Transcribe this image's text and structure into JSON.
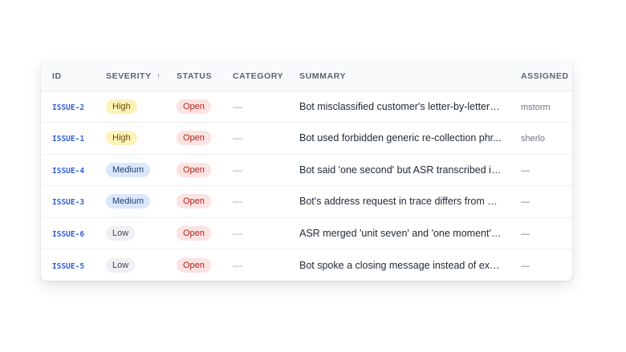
{
  "table": {
    "columns": {
      "id": "ID",
      "severity": "SEVERITY",
      "severity_sort_indicator": "↑",
      "status": "STATUS",
      "category": "CATEGORY",
      "summary": "SUMMARY",
      "assigned": "ASSIGNED"
    },
    "rows": [
      {
        "id": "ISSUE-2",
        "severity": "High",
        "status": "Open",
        "category": "—",
        "summary": "Bot misclassified customer's letter-by-letter s...",
        "assigned": "mstorm"
      },
      {
        "id": "ISSUE-1",
        "severity": "High",
        "status": "Open",
        "category": "—",
        "summary": "Bot used forbidden generic re-collection phr...",
        "assigned": "sherlo"
      },
      {
        "id": "ISSUE-4",
        "severity": "Medium",
        "status": "Open",
        "category": "—",
        "summary": "Bot said 'one second' but ASR transcribed it ...",
        "assigned": "—"
      },
      {
        "id": "ISSUE-3",
        "severity": "Medium",
        "status": "Open",
        "category": "—",
        "summary": "Bot's address request in trace differs from w...",
        "assigned": "—"
      },
      {
        "id": "ISSUE-6",
        "severity": "Low",
        "status": "Open",
        "category": "—",
        "summary": "ASR merged 'unit seven' and 'one moment' i...",
        "assigned": "—"
      },
      {
        "id": "ISSUE-5",
        "severity": "Low",
        "status": "Open",
        "category": "—",
        "summary": "Bot spoke a closing message instead of exec...",
        "assigned": "—"
      }
    ]
  },
  "colors": {
    "id_link": "#2f62d8",
    "severity_high_bg": "#fdf3b8",
    "severity_medium_bg": "#dbe7fb",
    "severity_low_bg": "#eef0f3",
    "status_open_bg": "#fde2e2",
    "status_open_text": "#b42318"
  }
}
